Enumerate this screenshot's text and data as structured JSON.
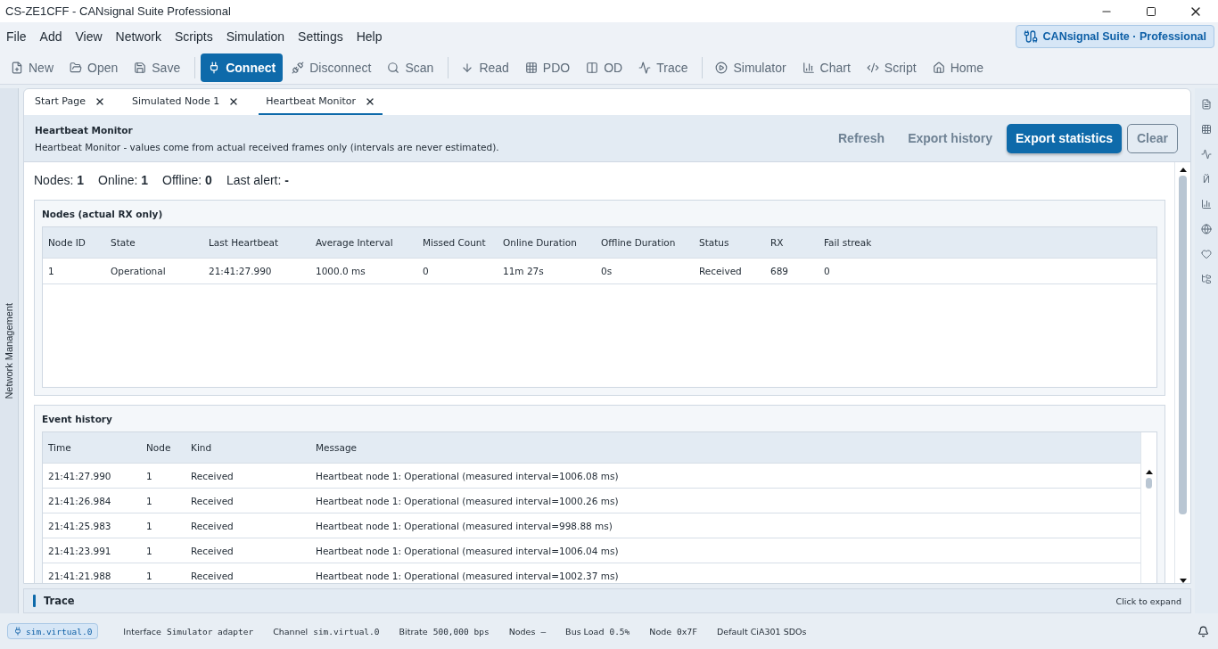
{
  "window": {
    "title": "CS-ZE1CFF - CANsignal Suite Professional"
  },
  "menu": [
    "File",
    "Add",
    "View",
    "Network",
    "Scripts",
    "Simulation",
    "Settings",
    "Help"
  ],
  "brand": {
    "name": "CANsignal Suite",
    "separator": "·",
    "edition": "Professional"
  },
  "toolbar": [
    {
      "label": "New",
      "primary": false,
      "separator_before": false
    },
    {
      "label": "Open",
      "primary": false,
      "separator_before": false
    },
    {
      "label": "Save",
      "primary": false,
      "separator_before": false
    },
    {
      "label": "Connect",
      "primary": true,
      "separator_before": true
    },
    {
      "label": "Disconnect",
      "primary": false,
      "separator_before": false
    },
    {
      "label": "Scan",
      "primary": false,
      "separator_before": false
    },
    {
      "label": "Read",
      "primary": false,
      "separator_before": true
    },
    {
      "label": "PDO",
      "primary": false,
      "separator_before": false
    },
    {
      "label": "OD",
      "primary": false,
      "separator_before": false
    },
    {
      "label": "Trace",
      "primary": false,
      "separator_before": false
    },
    {
      "label": "Simulator",
      "primary": false,
      "separator_before": true
    },
    {
      "label": "Chart",
      "primary": false,
      "separator_before": false
    },
    {
      "label": "Script",
      "primary": false,
      "separator_before": false
    },
    {
      "label": "Home",
      "primary": false,
      "separator_before": false
    }
  ],
  "left_panel": {
    "title": "Network Management"
  },
  "tabs": [
    {
      "label": "Start Page",
      "selected": false
    },
    {
      "label": "Simulated Node 1",
      "selected": false
    },
    {
      "label": "Heartbeat Monitor",
      "selected": true
    }
  ],
  "header": {
    "title": "Heartbeat Monitor",
    "description": "Heartbeat Monitor - values come from actual received frames only (intervals are never estimated).",
    "actions": [
      {
        "label": "Refresh",
        "kind": "text"
      },
      {
        "label": "Export history",
        "kind": "text"
      },
      {
        "label": "Export statistics",
        "kind": "primary"
      },
      {
        "label": "Clear",
        "kind": "outline"
      }
    ]
  },
  "summary": [
    {
      "label": "Nodes:",
      "value": "1"
    },
    {
      "label": "Online:",
      "value": "1"
    },
    {
      "label": "Offline:",
      "value": "0"
    },
    {
      "label": "Last alert:",
      "value": "-"
    }
  ],
  "nodes": {
    "title": "Nodes (actual RX only)",
    "columns": [
      "Node ID",
      "State",
      "Last Heartbeat",
      "Average Interval",
      "Missed Count",
      "Online Duration",
      "Offline Duration",
      "Status",
      "RX",
      "Fail streak"
    ],
    "rows": [
      [
        "1",
        "Operational",
        "21:41:27.990",
        "1000.0 ms",
        "0",
        "11m 27s",
        "0s",
        "Received",
        "689",
        "0"
      ]
    ]
  },
  "events": {
    "title": "Event history",
    "columns": [
      "Time",
      "Node",
      "Kind",
      "Message"
    ],
    "rows": [
      [
        "21:41:27.990",
        "1",
        "Received",
        "Heartbeat node 1: Operational (measured interval=1006.08 ms)"
      ],
      [
        "21:41:26.984",
        "1",
        "Received",
        "Heartbeat node 1: Operational (measured interval=1000.26 ms)"
      ],
      [
        "21:41:25.983",
        "1",
        "Received",
        "Heartbeat node 1: Operational (measured interval=998.88 ms)"
      ],
      [
        "21:41:23.991",
        "1",
        "Received",
        "Heartbeat node 1: Operational (measured interval=1006.04 ms)"
      ],
      [
        "21:41:21.988",
        "1",
        "Received",
        "Heartbeat node 1: Operational (measured interval=1002.37 ms)"
      ]
    ]
  },
  "right_rail": {
    "glyph": "Й"
  },
  "trace": {
    "title": "Trace",
    "hint": "Click to expand"
  },
  "status_bar": {
    "channel_chip": "sim.virtual.0",
    "items": [
      {
        "label": "Interface",
        "value": "Simulator adapter"
      },
      {
        "label": "Channel",
        "value": "sim.virtual.0"
      },
      {
        "label": "Bitrate",
        "value": "500,000 bps"
      },
      {
        "label": "Nodes",
        "value": "–"
      },
      {
        "label": "Bus Load",
        "value": "0.5%"
      },
      {
        "label": "Node",
        "value": "0x7F"
      }
    ],
    "note": "Default CiA301 SDOs"
  }
}
